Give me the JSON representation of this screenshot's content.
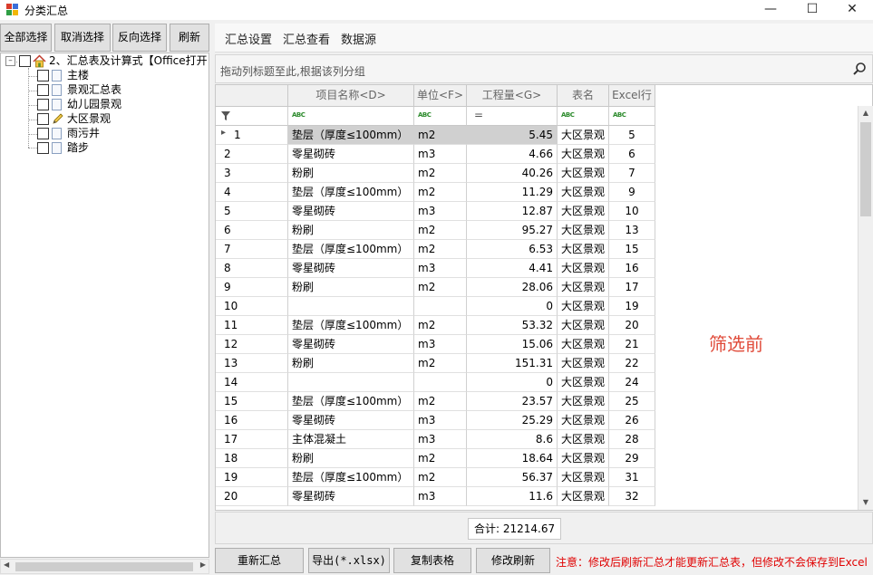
{
  "window": {
    "title": "分类汇总"
  },
  "toolbar": {
    "select_all": "全部选择",
    "deselect": "取消选择",
    "invert": "反向选择",
    "refresh": "刷新"
  },
  "tree": {
    "root": "2、汇总表及计算式【Office打开",
    "children": [
      "主楼",
      "景观汇总表",
      "幼儿园景观",
      "大区景观",
      "雨污井",
      "踏步"
    ]
  },
  "tabs": [
    "汇总设置",
    "汇总查看",
    "数据源"
  ],
  "grid": {
    "group_hint": "拖动列标题至此,根据该列分组",
    "columns": [
      "",
      "项目名称<D>",
      "单位<F>",
      "工程量<G>",
      "表名",
      "Excel行"
    ],
    "filter_eq": "=",
    "filter_abc": "ABC",
    "rows": [
      {
        "no": "1",
        "name": "垫层（厚度≤100mm）",
        "unit": "m2",
        "qty": "5.45",
        "table": "大区景观",
        "row": "5"
      },
      {
        "no": "2",
        "name": "零星砌砖",
        "unit": "m3",
        "qty": "4.66",
        "table": "大区景观",
        "row": "6"
      },
      {
        "no": "3",
        "name": "粉刷",
        "unit": "m2",
        "qty": "40.26",
        "table": "大区景观",
        "row": "7"
      },
      {
        "no": "4",
        "name": "垫层（厚度≤100mm）",
        "unit": "m2",
        "qty": "11.29",
        "table": "大区景观",
        "row": "9"
      },
      {
        "no": "5",
        "name": "零星砌砖",
        "unit": "m3",
        "qty": "12.87",
        "table": "大区景观",
        "row": "10"
      },
      {
        "no": "6",
        "name": "粉刷",
        "unit": "m2",
        "qty": "95.27",
        "table": "大区景观",
        "row": "13"
      },
      {
        "no": "7",
        "name": "垫层（厚度≤100mm）",
        "unit": "m2",
        "qty": "6.53",
        "table": "大区景观",
        "row": "15"
      },
      {
        "no": "8",
        "name": "零星砌砖",
        "unit": "m3",
        "qty": "4.41",
        "table": "大区景观",
        "row": "16"
      },
      {
        "no": "9",
        "name": "粉刷",
        "unit": "m2",
        "qty": "28.06",
        "table": "大区景观",
        "row": "17"
      },
      {
        "no": "10",
        "name": "",
        "unit": "",
        "qty": "0",
        "table": "大区景观",
        "row": "19"
      },
      {
        "no": "11",
        "name": "垫层（厚度≤100mm）",
        "unit": "m2",
        "qty": "53.32",
        "table": "大区景观",
        "row": "20"
      },
      {
        "no": "12",
        "name": "零星砌砖",
        "unit": "m3",
        "qty": "15.06",
        "table": "大区景观",
        "row": "21"
      },
      {
        "no": "13",
        "name": "粉刷",
        "unit": "m2",
        "qty": "151.31",
        "table": "大区景观",
        "row": "22"
      },
      {
        "no": "14",
        "name": "",
        "unit": "",
        "qty": "0",
        "table": "大区景观",
        "row": "24"
      },
      {
        "no": "15",
        "name": "垫层（厚度≤100mm）",
        "unit": "m2",
        "qty": "23.57",
        "table": "大区景观",
        "row": "25"
      },
      {
        "no": "16",
        "name": "零星砌砖",
        "unit": "m3",
        "qty": "25.29",
        "table": "大区景观",
        "row": "26"
      },
      {
        "no": "17",
        "name": "主体混凝土",
        "unit": "m3",
        "qty": "8.6",
        "table": "大区景观",
        "row": "28"
      },
      {
        "no": "18",
        "name": "粉刷",
        "unit": "m2",
        "qty": "18.64",
        "table": "大区景观",
        "row": "29"
      },
      {
        "no": "19",
        "name": "垫层（厚度≤100mm）",
        "unit": "m2",
        "qty": "56.37",
        "table": "大区景观",
        "row": "31"
      },
      {
        "no": "20",
        "name": "零星砌砖",
        "unit": "m3",
        "qty": "11.6",
        "table": "大区景观",
        "row": "32"
      }
    ],
    "total": "合计: 21214.67"
  },
  "annotation": "筛选前",
  "bottom": {
    "recalc": "重新汇总",
    "export": "导出(*.xlsx)",
    "copy": "复制表格",
    "modify_refresh": "修改刷新",
    "notice": "注意：修改后刷新汇总才能更新汇总表，但修改不会保存到Excel"
  },
  "colors": {
    "accent_red": "#e04b3a",
    "notice_red": "#e00000",
    "selected_row": "#d0d0d0"
  }
}
